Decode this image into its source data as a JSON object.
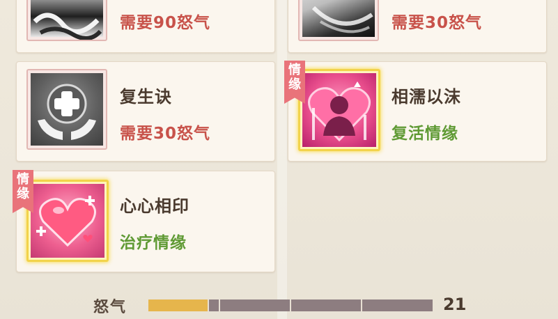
{
  "cards": [
    {
      "title": "",
      "requirement": "需要90怒气",
      "icon": "smoke-skill-icon",
      "sub_color": "#c8524a"
    },
    {
      "title": "",
      "requirement": "需要30怒气",
      "icon": "wing-skill-icon",
      "sub_color": "#c8524a"
    },
    {
      "title": "复生诀",
      "requirement": "需要30怒气",
      "icon": "revive-hands-cross-icon",
      "sub_color": "#c8524a"
    },
    {
      "title": "相濡以沫",
      "requirement": "复活情缘",
      "badge": "情缘",
      "icon": "bond-revive-silhouette-icon",
      "sub_color": "#5f9a34"
    },
    {
      "title": "心心相印",
      "requirement": "治疗情缘",
      "badge": "情缘",
      "icon": "bond-heal-heart-icon",
      "sub_color": "#5f9a34"
    }
  ],
  "rage": {
    "label": "怒气",
    "value": "21",
    "fill_fraction": 0.21,
    "segments": 4,
    "fill_color": "#e6b54c",
    "empty_color": "#8d7d80"
  }
}
